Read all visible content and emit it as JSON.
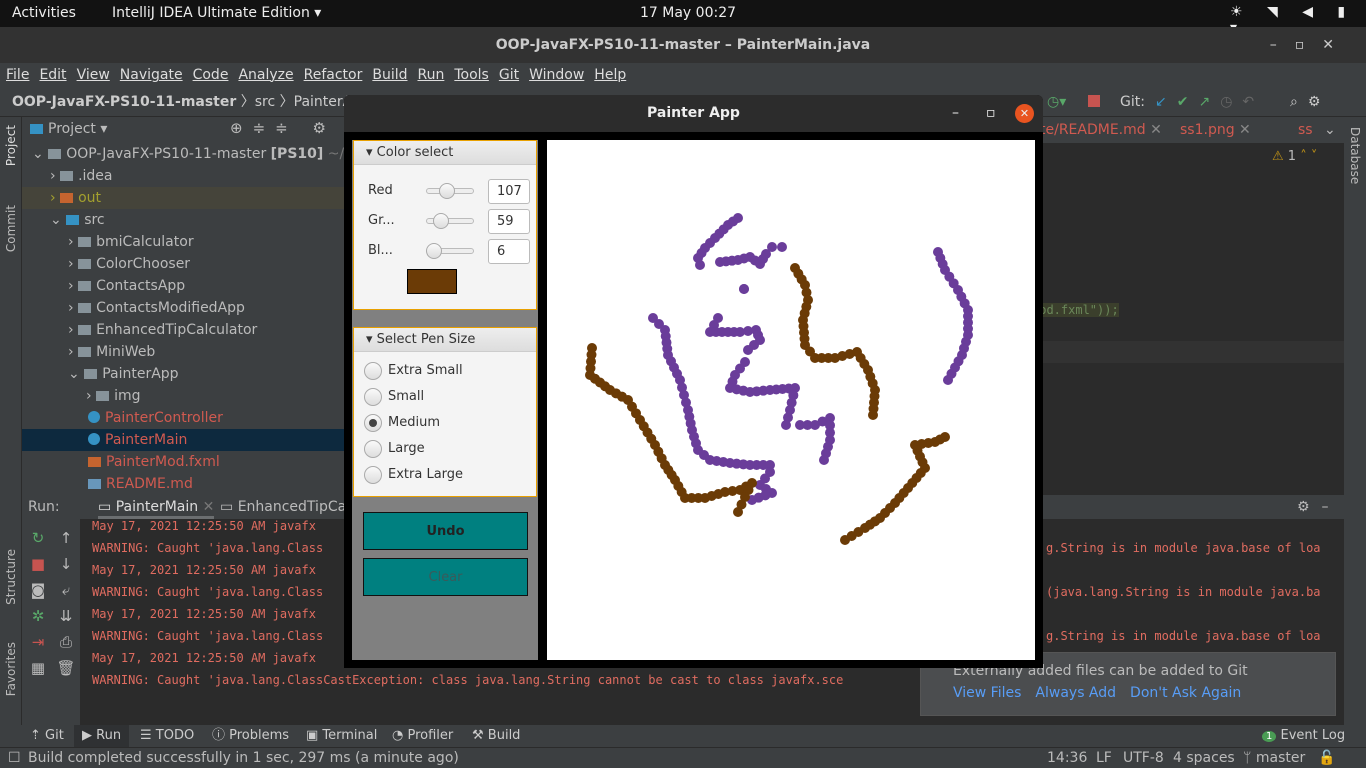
{
  "topbar": {
    "activities": "Activities",
    "app": "IntelliJ IDEA Ultimate Edition ▾",
    "datetime": "17 May  00:27"
  },
  "window_title": "OOP-JavaFX-PS10-11-master – PainterMain.java",
  "menu": [
    "File",
    "Edit",
    "View",
    "Navigate",
    "Code",
    "Analyze",
    "Refactor",
    "Build",
    "Run",
    "Tools",
    "Git",
    "Window",
    "Help"
  ],
  "breadcrumb": [
    "OOP-JavaFX-PS10-11-master",
    "src",
    "PainterAp"
  ],
  "toolbar": {
    "git_label": "Git:"
  },
  "left_strip": {
    "project": "Project",
    "commit": "Commit",
    "structure": "Structure",
    "favorites": "Favorites"
  },
  "right_strip": {
    "database": "Database"
  },
  "project": {
    "title": "Project ▾",
    "root": "OOP-JavaFX-PS10-11-master",
    "root_tag": "[PS10]",
    "root_path": "~/D",
    "items": [
      {
        "label": ".idea",
        "type": "folder"
      },
      {
        "label": "out",
        "type": "out"
      },
      {
        "label": "src",
        "type": "src"
      },
      {
        "label": "bmiCalculator",
        "type": "pkg"
      },
      {
        "label": "ColorChooser",
        "type": "pkg"
      },
      {
        "label": "ContactsApp",
        "type": "pkg"
      },
      {
        "label": "ContactsModifiedApp",
        "type": "pkg"
      },
      {
        "label": "EnhancedTipCalculator",
        "type": "pkg"
      },
      {
        "label": "MiniWeb",
        "type": "pkg"
      },
      {
        "label": "PainterApp",
        "type": "pkg"
      },
      {
        "label": "img",
        "type": "pkg"
      },
      {
        "label": "PainterController",
        "type": "class"
      },
      {
        "label": "PainterMain",
        "type": "class"
      },
      {
        "label": "PainterMod.fxml",
        "type": "fxml"
      },
      {
        "label": "README.md",
        "type": "md"
      }
    ]
  },
  "editor": {
    "tabs": [
      "te/README.md",
      "ss1.png",
      "ss"
    ],
    "warning_count": "1",
    "code_fragment": "Mod.fxml\"));"
  },
  "run": {
    "label": "Run:",
    "tabs": [
      "PainterMain",
      "EnhancedTipCa"
    ],
    "log_left": [
      "May 17, 2021 12:25:50 AM javafx",
      "WARNING: Caught 'java.lang.Class",
      "May 17, 2021 12:25:50 AM javafx",
      "WARNING: Caught 'java.lang.Class",
      "May 17, 2021 12:25:50 AM javafx",
      "WARNING: Caught 'java.lang.Class",
      "May 17, 2021 12:25:50 AM javafx",
      "WARNING: Caught 'java.lang.ClassCastException: class java.lang.String cannot be cast to class javafx.sce"
    ],
    "log_right": [
      "",
      "g.String is in module java.base of loa",
      "",
      "(java.lang.String is in module java.ba",
      "",
      "g.String is in module java.base of loa",
      "",
      ""
    ]
  },
  "notification": {
    "text": "Externally added files can be added to Git",
    "actions": [
      "View Files",
      "Always Add",
      "Don't Ask Again"
    ]
  },
  "bottom_tabs": [
    "Git",
    "Run",
    "TODO",
    "Problems",
    "Terminal",
    "Profiler",
    "Build"
  ],
  "event_log": {
    "count": "1",
    "label": "Event Log"
  },
  "status": {
    "message": "Build completed successfully in 1 sec, 297 ms (a minute ago)",
    "position": "14:36",
    "line_sep": "LF",
    "encoding": "UTF-8",
    "indent": "4 spaces",
    "branch": "master"
  },
  "painter": {
    "title": "Painter App",
    "color_select": {
      "title": "Color select",
      "red_label": "Red",
      "green_label": "Gr...",
      "blue_label": "Bl...",
      "red": 107,
      "green": 59,
      "blue": 6,
      "swatch": "#6b3b06"
    },
    "pen_size": {
      "title": "Select Pen Size",
      "options": [
        "Extra Small",
        "Small",
        "Medium",
        "Large",
        "Extra Large"
      ],
      "selected": "Medium"
    },
    "undo": "Undo",
    "clear": "Clear",
    "stroke_colors": {
      "purple": "#6a3d9a",
      "brown": "#6b3b06"
    }
  }
}
